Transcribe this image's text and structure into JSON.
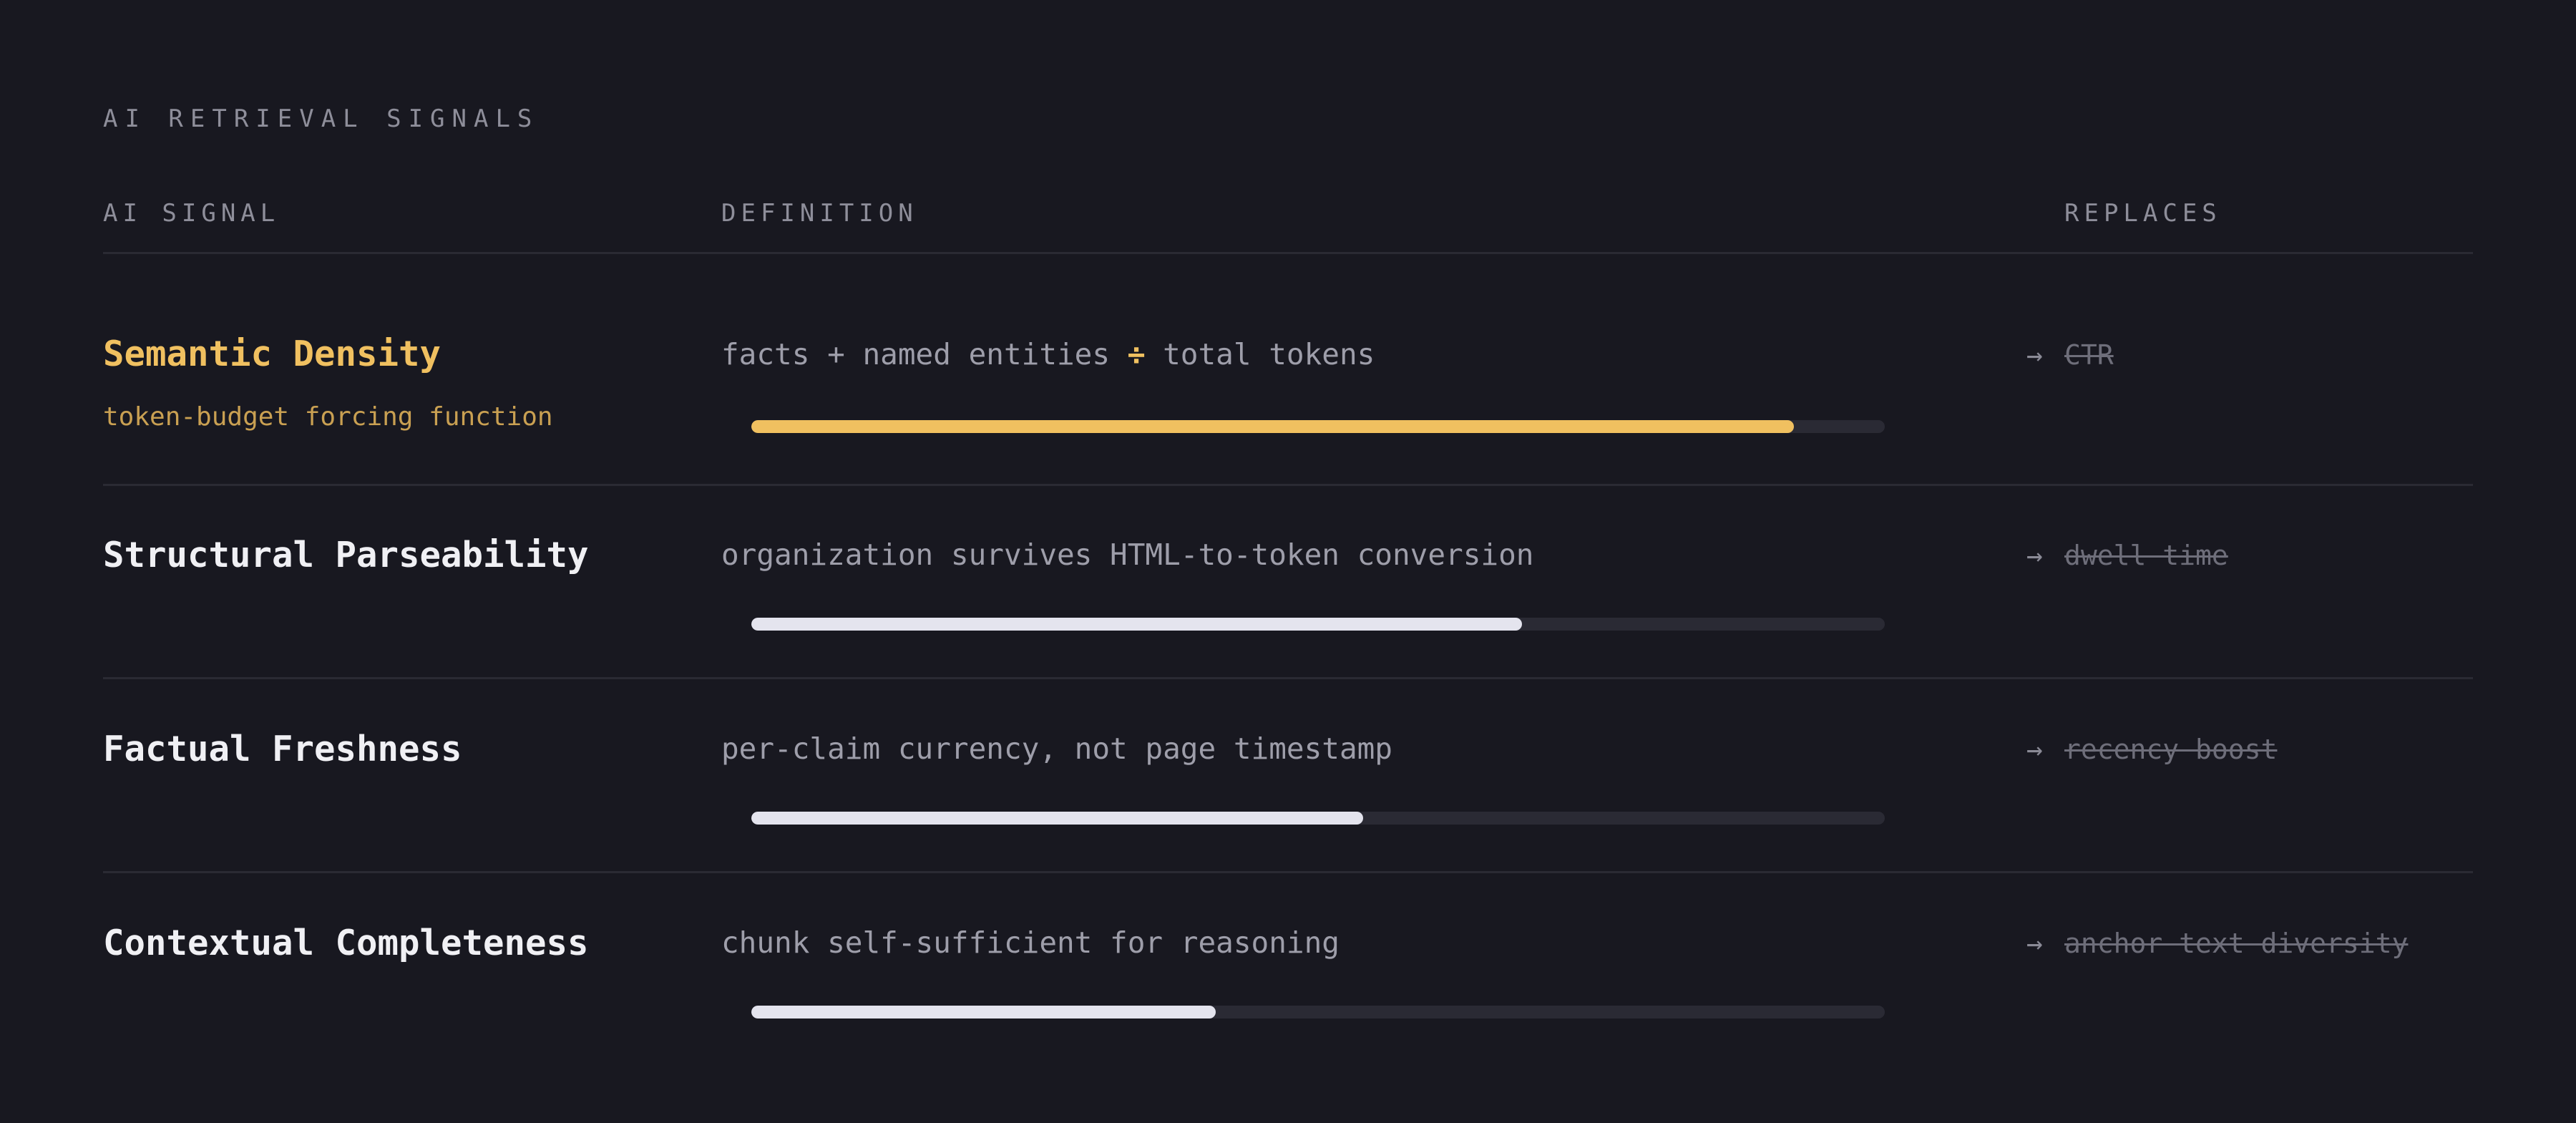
{
  "title": "AI RETRIEVAL SIGNALS",
  "headers": {
    "signal": "AI SIGNAL",
    "definition": "DEFINITION",
    "replaces": "REPLACES"
  },
  "colors": {
    "background": "#181820",
    "accent": "#f0c060",
    "bar_fill": "#e4e4ee",
    "bar_track": "#2a2a34"
  },
  "rows": [
    {
      "name": "Semantic Density",
      "subtitle": "token-budget forcing function",
      "definition_parts": [
        "facts + named entities ",
        "÷",
        " total tokens"
      ],
      "progress": 0.92,
      "arrow": "→",
      "replaces": "CTR",
      "highlighted": true
    },
    {
      "name": "Structural Parseability",
      "definition": "organization survives HTML-to-token conversion",
      "progress": 0.68,
      "arrow": "→",
      "replaces": "dwell time"
    },
    {
      "name": "Factual Freshness",
      "definition": "per-claim currency, not page timestamp",
      "progress": 0.54,
      "arrow": "→",
      "replaces": "recency boost"
    },
    {
      "name": "Contextual Completeness",
      "definition": "chunk self-sufficient for reasoning",
      "progress": 0.41,
      "arrow": "→",
      "replaces": "anchor text diversity"
    }
  ]
}
